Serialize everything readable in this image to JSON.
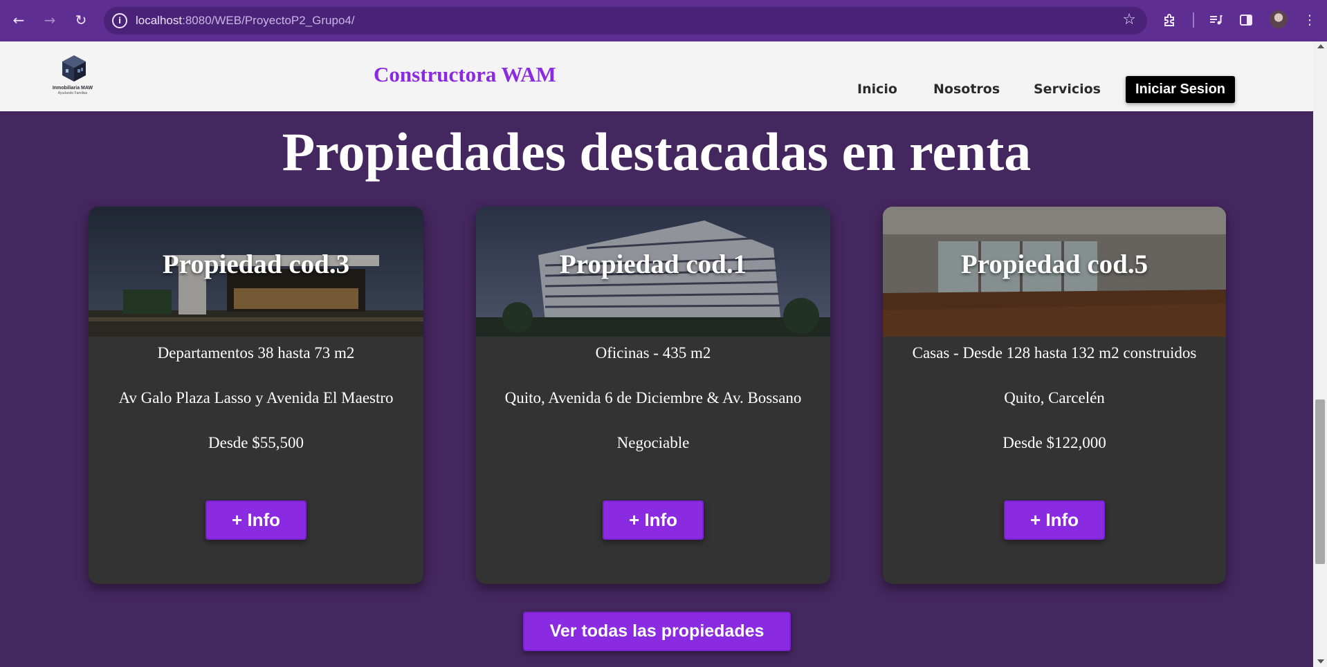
{
  "browser": {
    "url_host": "localhost",
    "url_path": ":8080/WEB/ProyectoP2_Grupo4/",
    "icons": {
      "back": "arrow-left",
      "forward": "arrow-right",
      "reload": "reload",
      "site_info": "info",
      "bookmark": "star",
      "extensions": "puzzle",
      "media": "media-queue",
      "side_panel": "side-panel",
      "profile": "avatar",
      "menu": "kebab"
    },
    "accent": "#5f2e93"
  },
  "header": {
    "logo_brand": "Inmobiliaria MAW",
    "logo_tagline": "Ayudando Familias",
    "site_title": "Constructora WAM",
    "nav": [
      "Inicio",
      "Nosotros",
      "Servicios"
    ],
    "login_label": "Iniciar Sesion"
  },
  "main": {
    "title": "Propiedades destacadas en renta",
    "cards": [
      {
        "name": "Propiedad cod.3",
        "type": "Departamentos 38 hasta 73 m2",
        "location": "Av Galo Plaza Lasso y Avenida El Maestro",
        "price": "Desde $55,500",
        "button": "+ Info"
      },
      {
        "name": "Propiedad cod.1",
        "type": "Oficinas - 435 m2",
        "location": "Quito, Avenida 6 de Diciembre & Av. Bossano",
        "price": "Negociable",
        "button": "+ Info"
      },
      {
        "name": "Propiedad cod.5",
        "type": "Casas - Desde 128 hasta 132 m2 construidos",
        "location": "Quito, Carcelén",
        "price": "Desde $122,000",
        "button": "+ Info"
      }
    ],
    "all_button": "Ver todas las propiedades"
  },
  "colors": {
    "page_background": "#45275f",
    "card_background": "#333333",
    "button_purple": "#8a2be2",
    "title_purple": "#8a2be2",
    "header_background": "#f4f4f4"
  }
}
